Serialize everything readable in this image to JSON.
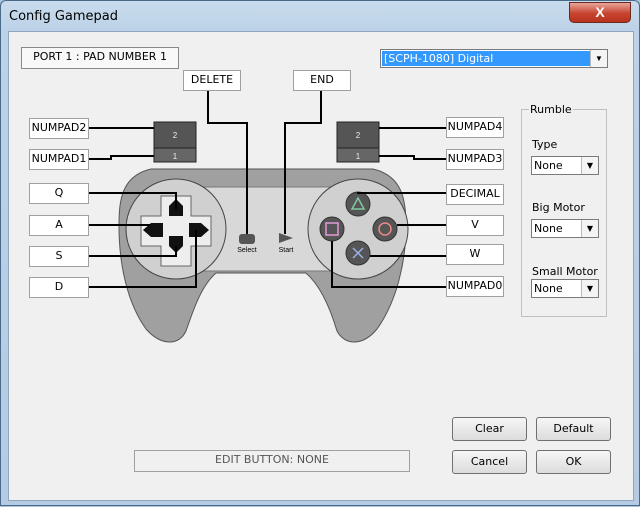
{
  "window": {
    "title": "Config Gamepad",
    "close_label": "X"
  },
  "port_label": "PORT 1 : PAD NUMBER 1",
  "pad_type": {
    "selected": "[SCPH-1080] Digital"
  },
  "top_buttons": {
    "select_key": "DELETE",
    "start_key": "END"
  },
  "left_keys": [
    "NUMPAD2",
    "NUMPAD1",
    "Q",
    "A",
    "S",
    "D"
  ],
  "right_keys": [
    "NUMPAD4",
    "NUMPAD3",
    "DECIMAL",
    "V",
    "W",
    "NUMPAD0"
  ],
  "pad_labels": {
    "select": "Select",
    "start": "Start",
    "l2": "2",
    "l1": "1",
    "r2": "2",
    "r1": "1"
  },
  "rumble": {
    "group_label": "Rumble",
    "type_label": "Type",
    "type_value": "None",
    "big_label": "Big Motor",
    "big_value": "None",
    "small_label": "Small Motor",
    "small_value": "None"
  },
  "edit_status": "EDIT BUTTON: NONE",
  "buttons": {
    "clear": "Clear",
    "default": "Default",
    "cancel": "Cancel",
    "ok": "OK"
  },
  "colors": {
    "selection": "#3399ff",
    "titlebar": "#bcd2e8",
    "close": "#c7442f"
  }
}
